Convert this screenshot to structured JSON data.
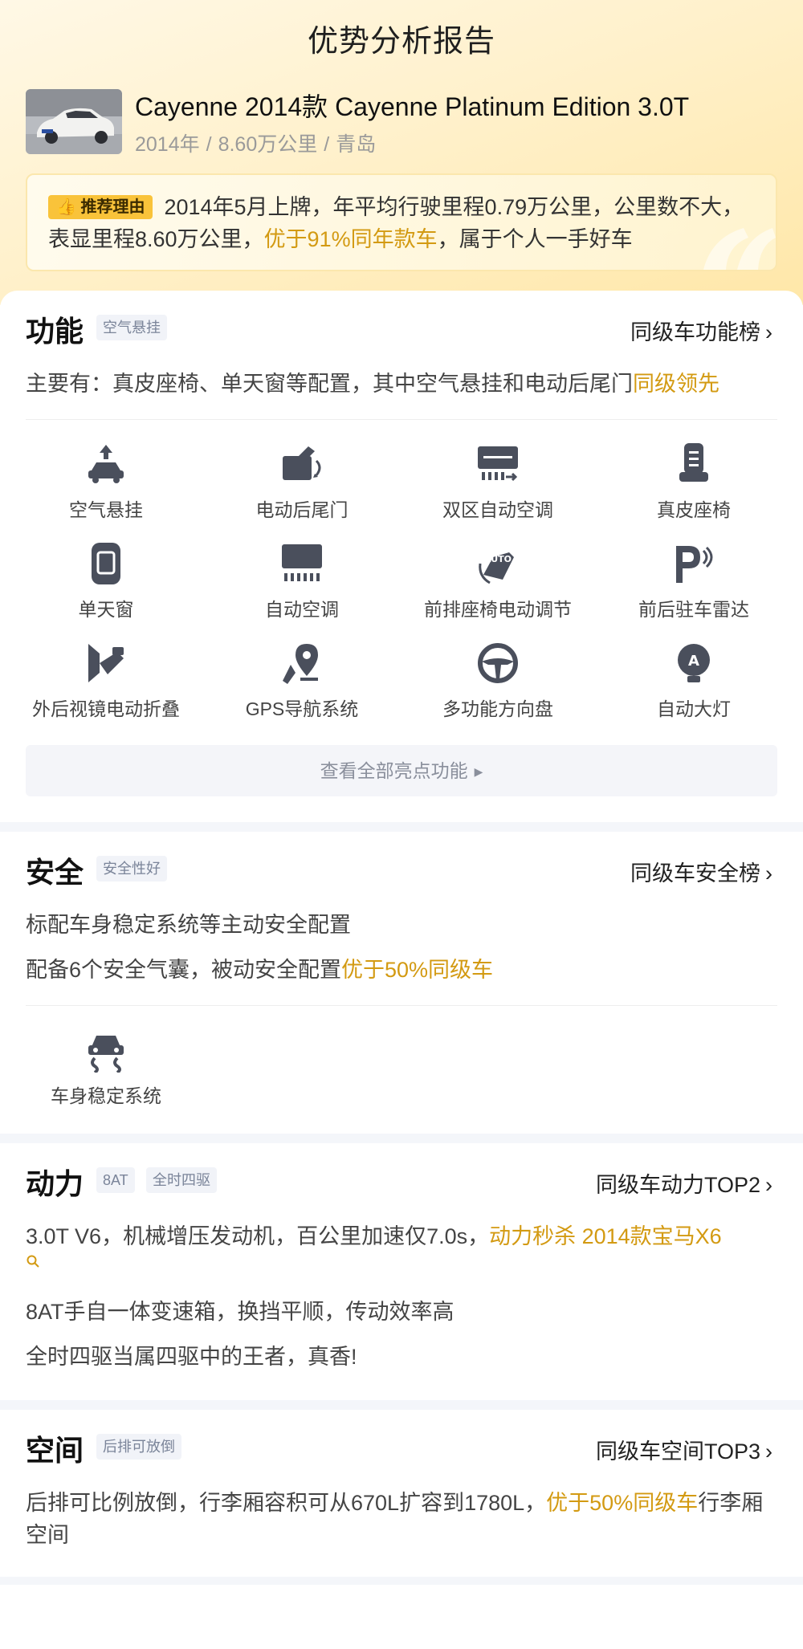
{
  "header": {
    "title": "优势分析报告"
  },
  "car": {
    "name": "Cayenne 2014款 Cayenne Platinum Edition 3.0T",
    "year": "2014年",
    "mileage": "8.60万公里",
    "city": "青岛",
    "separator": "/"
  },
  "reason": {
    "badge": "推荐理由",
    "text_before": "2014年5月上牌，年平均行驶里程0.79万公里，公里数不大，表显里程8.60万公里，",
    "highlight": "优于91%同年款车",
    "text_after": "，属于个人一手好车"
  },
  "function": {
    "title": "功能",
    "tag": "空气悬挂",
    "rank_link": "同级车功能榜",
    "desc_before": "主要有：真皮座椅、单天窗等配置，其中空气悬挂和电动后尾门",
    "desc_highlight": "同级领先",
    "features": [
      {
        "label": "空气悬挂",
        "icon": "air-suspension-icon"
      },
      {
        "label": "电动后尾门",
        "icon": "power-tailgate-icon"
      },
      {
        "label": "双区自动空调",
        "icon": "dual-zone-ac-icon"
      },
      {
        "label": "真皮座椅",
        "icon": "leather-seat-icon"
      },
      {
        "label": "单天窗",
        "icon": "sunroof-icon"
      },
      {
        "label": "自动空调",
        "icon": "auto-ac-icon"
      },
      {
        "label": "前排座椅电动调节",
        "icon": "power-seat-icon"
      },
      {
        "label": "前后驻车雷达",
        "icon": "parking-radar-icon"
      },
      {
        "label": "外后视镜电动折叠",
        "icon": "mirror-fold-icon"
      },
      {
        "label": "GPS导航系统",
        "icon": "gps-icon"
      },
      {
        "label": "多功能方向盘",
        "icon": "steering-wheel-icon"
      },
      {
        "label": "自动大灯",
        "icon": "auto-headlight-icon"
      }
    ],
    "view_all": "查看全部亮点功能",
    "auto_text": "AUTO",
    "headlight_text": "A"
  },
  "safety": {
    "title": "安全",
    "tag": "安全性好",
    "rank_link": "同级车安全榜",
    "line1": "标配车身稳定系统等主动安全配置",
    "line2_before": "配备6个安全气囊，被动安全配置",
    "line2_highlight": "优于50%同级车",
    "feature": {
      "label": "车身稳定系统",
      "icon": "stability-control-icon"
    }
  },
  "power": {
    "title": "动力",
    "tags": [
      "8AT",
      "全时四驱"
    ],
    "rank_link": "同级车动力TOP2",
    "line1_before": "3.0T V6，机械增压发动机，百公里加速仅7.0s，",
    "line1_highlight": "动力秒杀 2014款宝马X6",
    "line2": "8AT手自一体变速箱，换挡平顺，传动效率高",
    "line3": "全时四驱当属四驱中的王者，真香!"
  },
  "space": {
    "title": "空间",
    "tag": "后排可放倒",
    "rank_link": "同级车空间TOP3",
    "desc_before": "后排可比例放倒，行李厢容积可从670L扩容到1780L，",
    "desc_highlight": "优于50%同级车",
    "desc_after": "行李厢空间"
  },
  "colors": {
    "accent": "#d39a12",
    "badge": "#f9c33a",
    "icon": "#4a4f5c"
  }
}
